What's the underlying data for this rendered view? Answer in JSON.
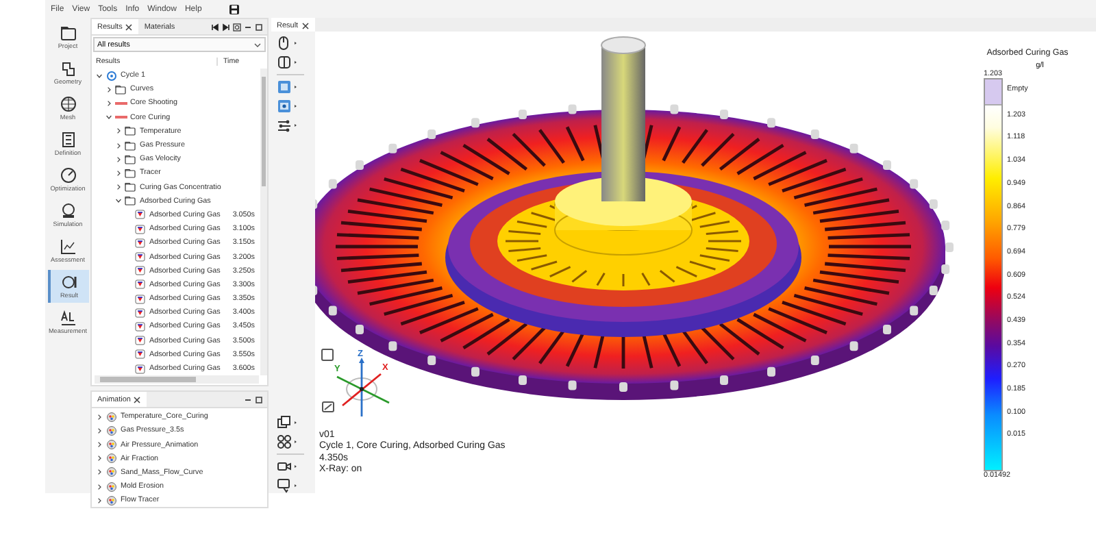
{
  "menu": [
    "File",
    "View",
    "Tools",
    "Info",
    "Window",
    "Help"
  ],
  "sidebar": {
    "items": [
      {
        "label": "Project",
        "selected": false
      },
      {
        "label": "Geometry",
        "selected": false
      },
      {
        "label": "Mesh",
        "selected": false
      },
      {
        "label": "Definition",
        "selected": false
      },
      {
        "label": "Optimization",
        "selected": false
      },
      {
        "label": "Simulation",
        "selected": false
      },
      {
        "label": "Assessment",
        "selected": false
      },
      {
        "label": "Result",
        "selected": true
      },
      {
        "label": "Measurement",
        "selected": false
      }
    ]
  },
  "results_panel": {
    "tabs": [
      {
        "label": "Results",
        "closable": true,
        "selected": true
      },
      {
        "label": "Materials",
        "closable": false,
        "selected": false
      }
    ],
    "filter": "All results",
    "columns": [
      "Results",
      "Time"
    ],
    "tree": [
      {
        "label": "Cycle 1",
        "kind": "cycle",
        "expanded": true,
        "children": [
          {
            "label": "Curves",
            "kind": "folder",
            "expanded": false
          },
          {
            "label": "Core Shooting",
            "kind": "curve",
            "expanded": false
          },
          {
            "label": "Core Curing",
            "kind": "curve",
            "expanded": true,
            "children": [
              {
                "label": "Temperature",
                "kind": "folder",
                "expanded": false
              },
              {
                "label": "Gas Pressure",
                "kind": "folder",
                "expanded": false
              },
              {
                "label": "Gas Velocity",
                "kind": "folder",
                "expanded": false
              },
              {
                "label": "Tracer",
                "kind": "folder",
                "expanded": false
              },
              {
                "label": "Curing Gas Concentratio",
                "kind": "folder",
                "expanded": false
              },
              {
                "label": "Adsorbed Curing Gas",
                "kind": "folder",
                "expanded": true,
                "children": [
                  {
                    "label": "Adsorbed Curing Gas",
                    "kind": "result",
                    "time": "3.050s"
                  },
                  {
                    "label": "Adsorbed Curing Gas",
                    "kind": "result",
                    "time": "3.100s"
                  },
                  {
                    "label": "Adsorbed Curing Gas",
                    "kind": "result",
                    "time": "3.150s"
                  },
                  {
                    "label": "Adsorbed Curing Gas",
                    "kind": "result",
                    "time": "3.200s"
                  },
                  {
                    "label": "Adsorbed Curing Gas",
                    "kind": "result",
                    "time": "3.250s"
                  },
                  {
                    "label": "Adsorbed Curing Gas",
                    "kind": "result",
                    "time": "3.300s"
                  },
                  {
                    "label": "Adsorbed Curing Gas",
                    "kind": "result",
                    "time": "3.350s"
                  },
                  {
                    "label": "Adsorbed Curing Gas",
                    "kind": "result",
                    "time": "3.400s"
                  },
                  {
                    "label": "Adsorbed Curing Gas",
                    "kind": "result",
                    "time": "3.450s"
                  },
                  {
                    "label": "Adsorbed Curing Gas",
                    "kind": "result",
                    "time": "3.500s"
                  },
                  {
                    "label": "Adsorbed Curing Gas",
                    "kind": "result",
                    "time": "3.550s"
                  },
                  {
                    "label": "Adsorbed Curing Gas",
                    "kind": "result",
                    "time": "3.600s"
                  }
                ]
              }
            ]
          }
        ]
      }
    ]
  },
  "animation_panel": {
    "tab": "Animation",
    "items": [
      {
        "label": "Temperature_Core_Curing",
        "expanded": false
      },
      {
        "label": "Gas Pressure_3.5s",
        "expanded": false
      },
      {
        "label": "Air Pressure_Animation",
        "expanded": false
      },
      {
        "label": "Air Fraction",
        "expanded": false
      },
      {
        "label": "Sand_Mass_Flow_Curve",
        "expanded": false
      },
      {
        "label": "Mold Erosion",
        "expanded": false
      },
      {
        "label": "Flow Tracer",
        "expanded": false
      }
    ]
  },
  "viewport": {
    "tab": "Result",
    "axes": {
      "x": "X",
      "y": "Y",
      "z": "Z"
    },
    "info": [
      "v01",
      "Cycle 1, Core Curing, Adsorbed Curing Gas",
      "4.350s",
      "X-Ray: on"
    ],
    "legend": {
      "title": "Adsorbed Curing Gas",
      "unit": "g/l",
      "max": "1.203",
      "empty": "Empty",
      "ticks": [
        "1.203",
        "1.118",
        "1.034",
        "0.949",
        "0.864",
        "0.779",
        "0.694",
        "0.609",
        "0.524",
        "0.439",
        "0.354",
        "0.270",
        "0.185",
        "0.100",
        "0.015"
      ],
      "min": "0.01492"
    }
  }
}
